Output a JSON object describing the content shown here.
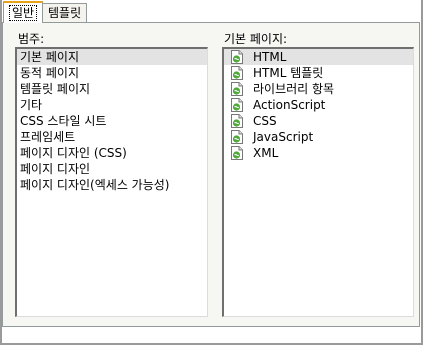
{
  "tabs": [
    {
      "label": "일반",
      "active": true
    },
    {
      "label": "템플릿",
      "active": false
    }
  ],
  "category": {
    "label": "범주:",
    "items": [
      {
        "label": "기본 페이지",
        "selected": true
      },
      {
        "label": "동적 페이지"
      },
      {
        "label": "템플릿 페이지"
      },
      {
        "label": "기타"
      },
      {
        "label": "CSS 스타일 시트"
      },
      {
        "label": "프레임세트"
      },
      {
        "label": "페이지 디자인 (CSS)"
      },
      {
        "label": "페이지 디자인"
      },
      {
        "label": "페이지 디자인(엑세스 가능성)"
      }
    ]
  },
  "basic_page": {
    "label": "기본 페이지:",
    "items": [
      {
        "label": "HTML",
        "icon": "document-icon",
        "selected": true
      },
      {
        "label": "HTML 템플릿",
        "icon": "document-icon"
      },
      {
        "label": "라이브러리 항목",
        "icon": "document-icon"
      },
      {
        "label": "ActionScript",
        "icon": "document-icon"
      },
      {
        "label": "CSS",
        "icon": "document-icon"
      },
      {
        "label": "JavaScript",
        "icon": "document-icon"
      },
      {
        "label": "XML",
        "icon": "document-icon"
      }
    ]
  },
  "colors": {
    "selection": "#e3e3e3",
    "panel_bg": "#f6f6f3",
    "tab_accent": "#e8a317",
    "icon_green": "#4fa83a"
  }
}
